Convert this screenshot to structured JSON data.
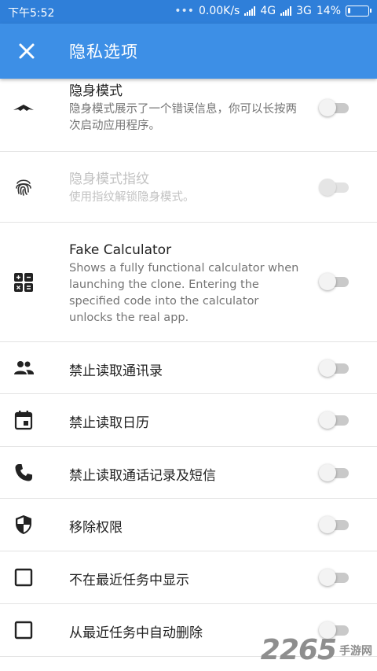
{
  "status_bar": {
    "time": "下午5:52",
    "dots": "•••",
    "net_speed": "0.00K/s",
    "network_1": "4G",
    "network_2": "3G",
    "battery": "14%",
    "battery_level": 0.14
  },
  "toolbar": {
    "title": "隐私选项",
    "close_icon": "close-icon"
  },
  "settings": [
    {
      "icon": "stealth-icon",
      "title": "隐身模式",
      "desc": "隐身模式展示了一个错误信息，你可以长按两次启动应用程序。",
      "enabled": true,
      "on": false
    },
    {
      "icon": "fingerprint-icon",
      "title": "隐身模式指纹",
      "desc": "使用指纹解锁隐身模式。",
      "enabled": false,
      "on": false
    },
    {
      "icon": "calculator-icon",
      "title": "Fake Calculator",
      "desc": "Shows a fully functional calculator when launching the clone. Entering the specified code into the calculator unlocks the real app.",
      "enabled": true,
      "on": false
    },
    {
      "icon": "contacts-icon",
      "title": "禁止读取通讯录",
      "enabled": true,
      "on": false
    },
    {
      "icon": "calendar-icon",
      "title": "禁止读取日历",
      "enabled": true,
      "on": false
    },
    {
      "icon": "phone-icon",
      "title": "禁止读取通话记录及短信",
      "enabled": true,
      "on": false
    },
    {
      "icon": "shield-icon",
      "title": "移除权限",
      "enabled": true,
      "on": false
    },
    {
      "icon": "checkbox-icon",
      "title": "不在最近任务中显示",
      "enabled": true,
      "on": false
    },
    {
      "icon": "checkbox-icon",
      "title": "从最近任务中自动删除",
      "enabled": true,
      "on": false
    }
  ],
  "watermark": {
    "number": "2265",
    "site": "手游网"
  }
}
